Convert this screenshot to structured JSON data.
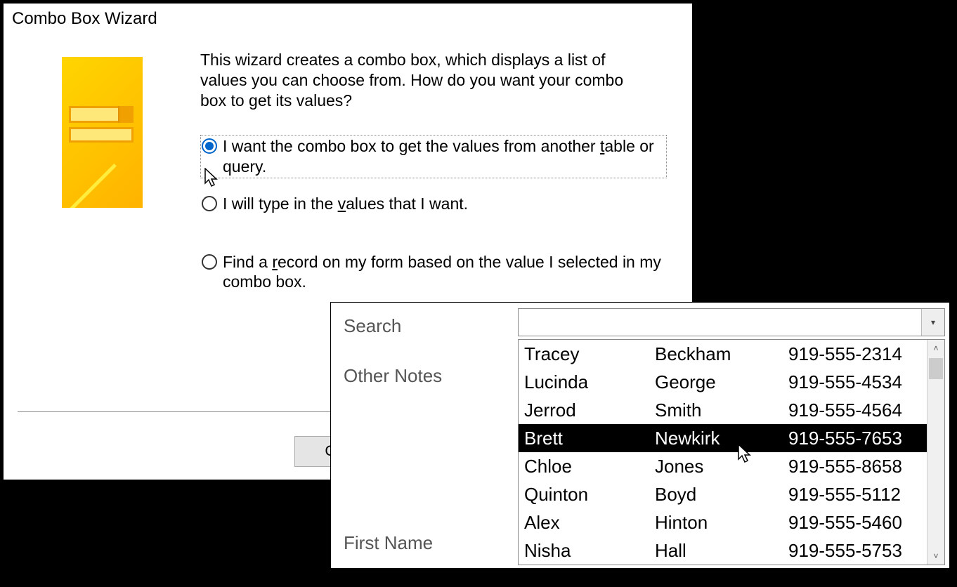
{
  "wizard": {
    "title": "Combo Box Wizard",
    "intro": "This wizard creates a combo box, which displays a list of values you can choose from.  How do you want your combo box to get its values?",
    "options": {
      "opt1_a": "I want the combo box to get the values from another ",
      "opt1_b": "t",
      "opt1_c": "able or query.",
      "opt2_a": "I will type in the ",
      "opt2_b": "v",
      "opt2_c": "alues that I want.",
      "opt3_a": "Find a ",
      "opt3_b": "r",
      "opt3_c": "ecord on my form based on the value I selected in my combo box."
    },
    "buttons": {
      "cancel": "Cancel"
    }
  },
  "panel": {
    "labels": {
      "search": "Search",
      "other": "Other Notes",
      "first": "First Name"
    },
    "rows": [
      {
        "first": "Tracey",
        "last": "Beckham",
        "phone": "919-555-2314"
      },
      {
        "first": "Lucinda",
        "last": "George",
        "phone": "919-555-4534"
      },
      {
        "first": "Jerrod",
        "last": "Smith",
        "phone": "919-555-4564"
      },
      {
        "first": "Brett",
        "last": "Newkirk",
        "phone": "919-555-7653"
      },
      {
        "first": "Chloe",
        "last": "Jones",
        "phone": "919-555-8658"
      },
      {
        "first": "Quinton",
        "last": "Boyd",
        "phone": "919-555-5112"
      },
      {
        "first": "Alex",
        "last": "Hinton",
        "phone": "919-555-5460"
      },
      {
        "first": "Nisha",
        "last": "Hall",
        "phone": "919-555-5753"
      }
    ],
    "selected_index": 3
  }
}
